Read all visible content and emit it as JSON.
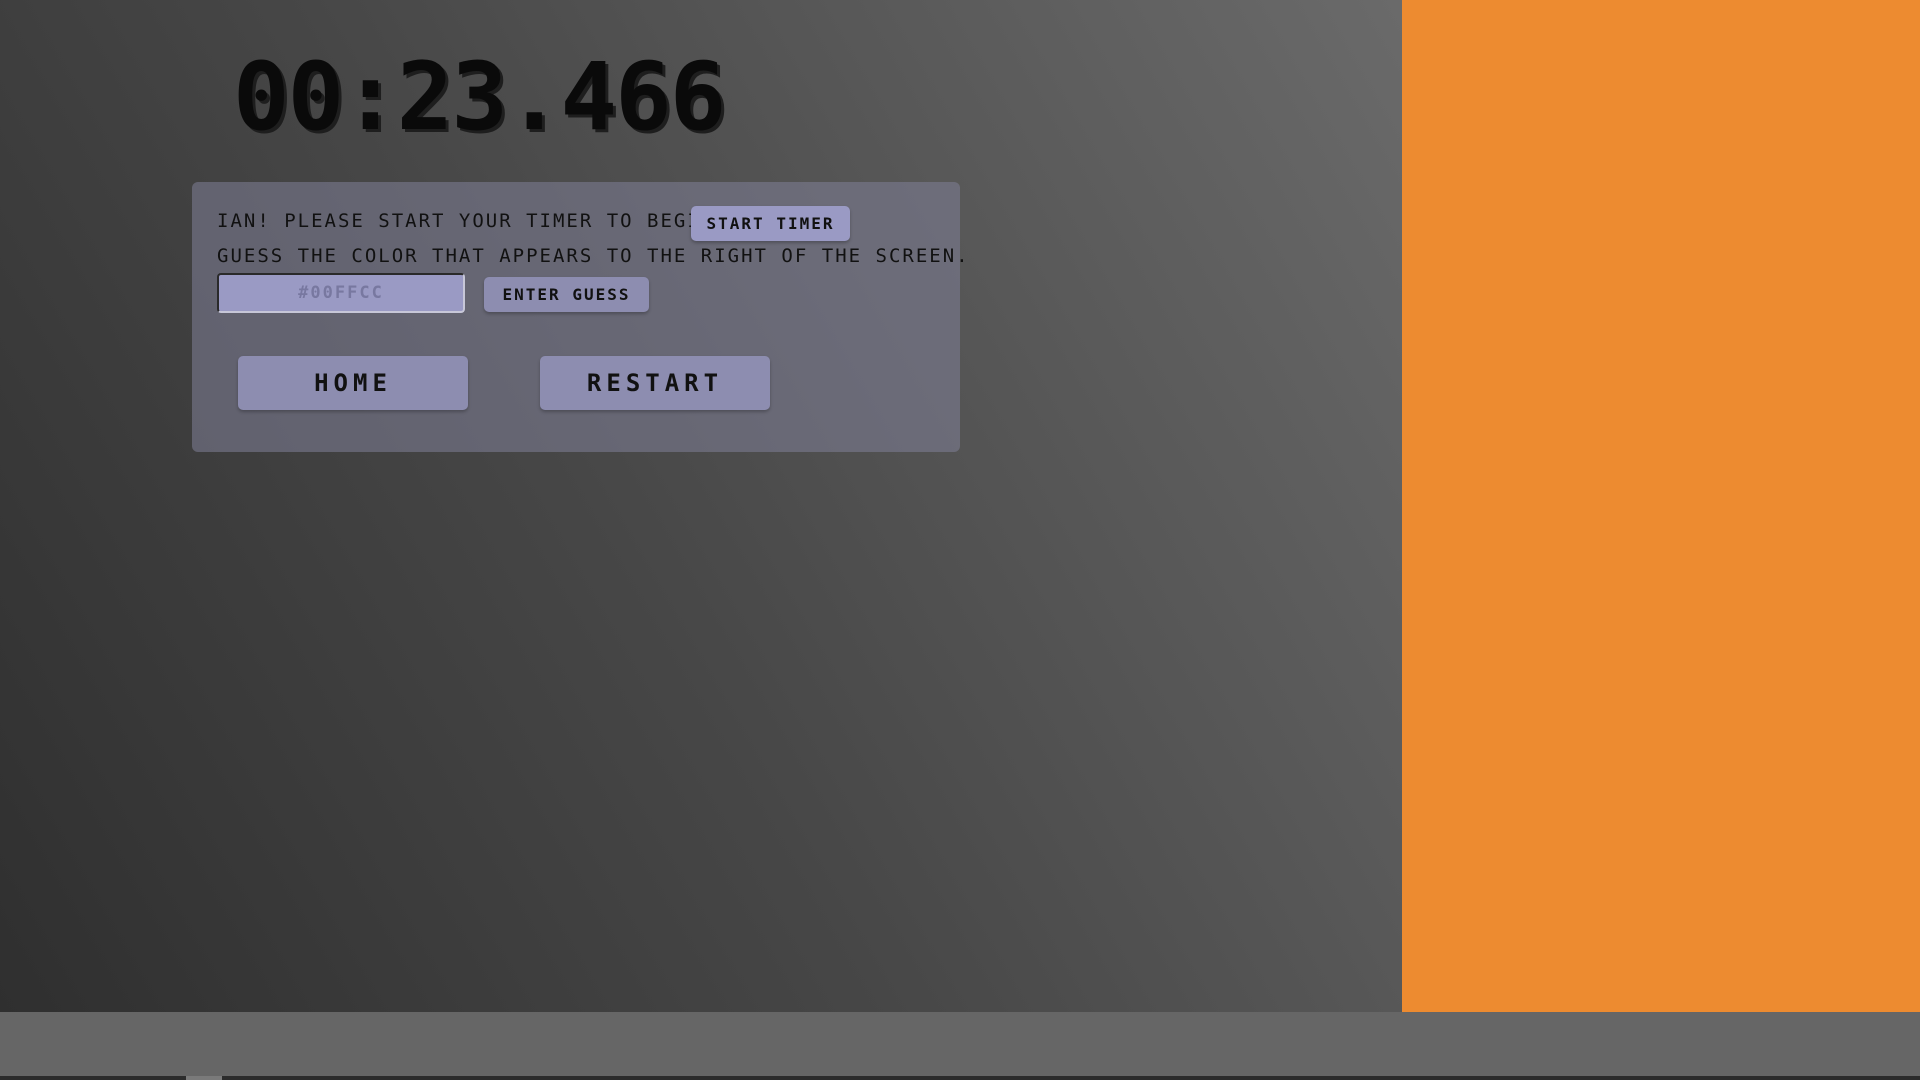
{
  "timer": {
    "display": "00:23.466"
  },
  "prompt": {
    "line1": "Ian! Please start your timer to begin",
    "line2": "Guess the color that appears to the right of the screen."
  },
  "buttons": {
    "start_timer": "Start Timer",
    "enter_guess": "Enter Guess",
    "home": "Home",
    "restart": "Restart"
  },
  "guess_input": {
    "value": "",
    "placeholder": "#00FFCC"
  },
  "color_panel": {
    "color": "#ED8B30"
  },
  "colors": {
    "panel_background": "#80809A",
    "button": "#8D8DB0",
    "timer_text": "#0A0A0A"
  }
}
